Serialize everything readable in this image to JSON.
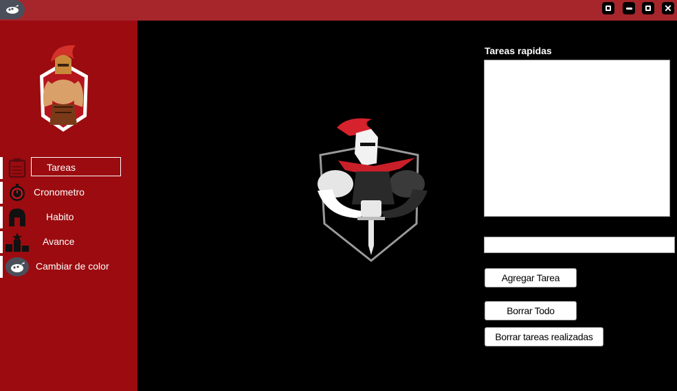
{
  "nav": [
    {
      "label": "Tareas",
      "icon": "clipboard-icon",
      "active": true
    },
    {
      "label": "Cronometro",
      "icon": "stopwatch-icon"
    },
    {
      "label": "Habito",
      "icon": "helmet-icon"
    },
    {
      "label": "Avance",
      "icon": "podium-icon"
    },
    {
      "label": "Cambiar de color",
      "icon": "palette-icon"
    }
  ],
  "quick_tasks": {
    "title": "Tareas rapidas",
    "items": [],
    "input_value": ""
  },
  "buttons": {
    "add": "Agregar Tarea",
    "clear_all": "Borrar Todo",
    "clear_done": "Borrar tareas realizadas"
  },
  "colors": {
    "titlebar": "#a6262c",
    "sidebar": "#9b0b0f",
    "content_bg": "#000000"
  }
}
